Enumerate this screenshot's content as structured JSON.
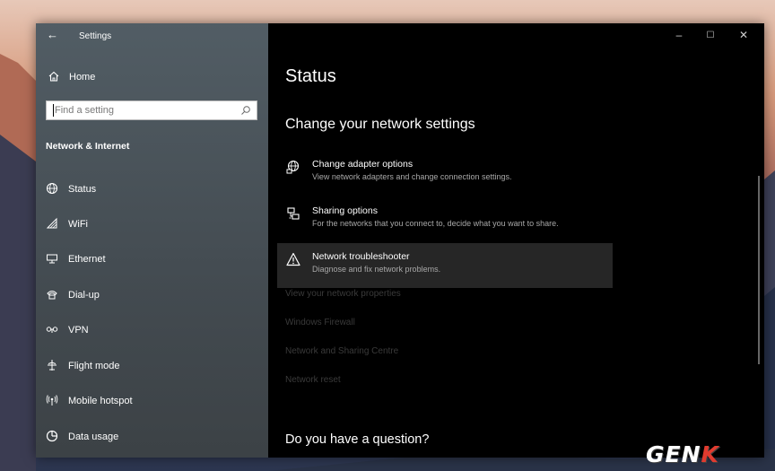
{
  "window": {
    "title": "Settings",
    "controls": {
      "minimize": "–",
      "maximize": "☐",
      "close": "✕"
    }
  },
  "sidebar": {
    "home_label": "Home",
    "search_placeholder": "Find a setting",
    "section_title": "Network & Internet",
    "items": [
      {
        "label": "Status",
        "icon": "status-globe-icon"
      },
      {
        "label": "WiFi",
        "icon": "wifi-icon"
      },
      {
        "label": "Ethernet",
        "icon": "ethernet-icon"
      },
      {
        "label": "Dial-up",
        "icon": "dial-up-icon"
      },
      {
        "label": "VPN",
        "icon": "vpn-icon"
      },
      {
        "label": "Flight mode",
        "icon": "airplane-icon"
      },
      {
        "label": "Mobile hotspot",
        "icon": "hotspot-icon"
      },
      {
        "label": "Data usage",
        "icon": "data-usage-icon"
      }
    ]
  },
  "main": {
    "page_title": "Status",
    "section_title": "Change your network settings",
    "options": [
      {
        "title": "Change adapter options",
        "desc": "View network adapters and change connection settings.",
        "icon": "adapter-icon"
      },
      {
        "title": "Sharing options",
        "desc": "For the networks that you connect to, decide what you want to share.",
        "icon": "sharing-icon"
      },
      {
        "title": "Network troubleshooter",
        "desc": "Diagnose and fix network problems.",
        "icon": "warning-icon"
      }
    ],
    "links": [
      "View your network properties",
      "Windows Firewall",
      "Network and Sharing Centre",
      "Network reset"
    ],
    "footer_question": "Do you have a question?"
  },
  "watermark": {
    "text_main": "GEN",
    "text_accent": "K"
  }
}
